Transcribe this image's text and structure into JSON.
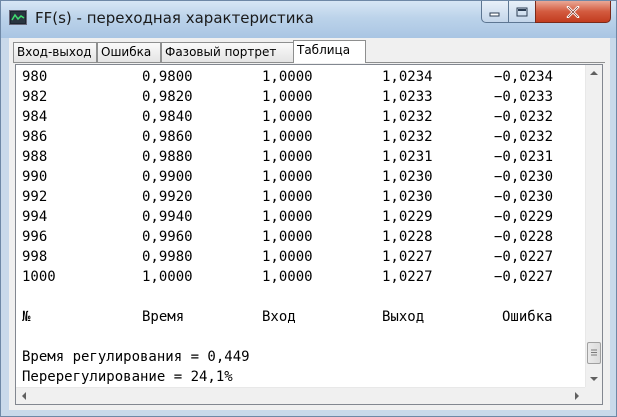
{
  "window": {
    "title": "FF(s) - переходная характеристика"
  },
  "tabs": [
    "Вход-выход",
    "Ошибка",
    "Фазовый портрет",
    "Таблица"
  ],
  "active_tab": "Таблица",
  "table": {
    "rows": [
      [
        "980",
        "0,9800",
        "1,0000",
        "1,0234",
        "−0,0234"
      ],
      [
        "982",
        "0,9820",
        "1,0000",
        "1,0233",
        "−0,0233"
      ],
      [
        "984",
        "0,9840",
        "1,0000",
        "1,0232",
        "−0,0232"
      ],
      [
        "986",
        "0,9860",
        "1,0000",
        "1,0232",
        "−0,0232"
      ],
      [
        "988",
        "0,9880",
        "1,0000",
        "1,0231",
        "−0,0231"
      ],
      [
        "990",
        "0,9900",
        "1,0000",
        "1,0230",
        "−0,0230"
      ],
      [
        "992",
        "0,9920",
        "1,0000",
        "1,0230",
        "−0,0230"
      ],
      [
        "994",
        "0,9940",
        "1,0000",
        "1,0229",
        "−0,0229"
      ],
      [
        "996",
        "0,9960",
        "1,0000",
        "1,0228",
        "−0,0228"
      ],
      [
        "998",
        "0,9980",
        "1,0000",
        "1,0227",
        "−0,0227"
      ],
      [
        "1000",
        "1,0000",
        "1,0000",
        "1,0227",
        "−0,0227"
      ]
    ],
    "headers": [
      "№",
      "Время",
      "Вход",
      "Выход",
      "Ошибка"
    ]
  },
  "summary": {
    "settling_time": "Время регулирования = 0,449",
    "overshoot": "Перерегулирование = 24,1%"
  }
}
